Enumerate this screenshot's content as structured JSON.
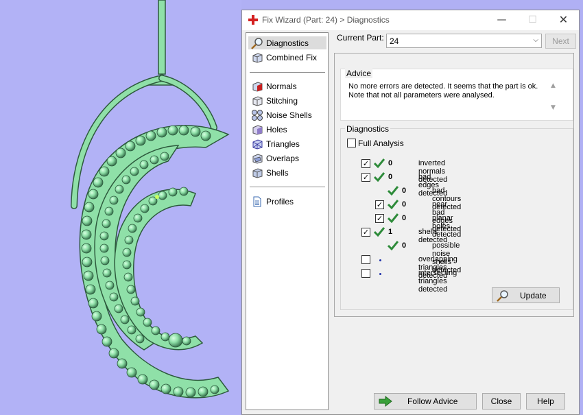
{
  "window": {
    "title": "Fix Wizard (Part: 24) > Diagnostics",
    "min_glyph": "—",
    "max_glyph": "☐",
    "close_glyph": "✕"
  },
  "sidebar": {
    "top_items": [
      {
        "label": "Diagnostics",
        "icon": "magnifier-icon",
        "selected": true
      },
      {
        "label": "Combined Fix",
        "icon": "cube-icon",
        "selected": false
      }
    ],
    "tool_items": [
      {
        "label": "Normals",
        "icon": "normals-cube-icon"
      },
      {
        "label": "Stitching",
        "icon": "stitching-cube-icon"
      },
      {
        "label": "Noise Shells",
        "icon": "noise-shells-icon"
      },
      {
        "label": "Holes",
        "icon": "holes-cube-icon"
      },
      {
        "label": "Triangles",
        "icon": "triangles-cube-icon"
      },
      {
        "label": "Overlaps",
        "icon": "overlaps-cube-icon"
      },
      {
        "label": "Shells",
        "icon": "shells-cube-icon"
      }
    ],
    "bottom_items": [
      {
        "label": "Profiles",
        "icon": "document-icon"
      }
    ]
  },
  "part": {
    "label": "Current Part:",
    "value": "24",
    "next_label": "Next"
  },
  "advice": {
    "title": "Advice",
    "text_line1": "No more errors are detected. It seems that the part is ok.",
    "text_line2": "Note that not all parameters were analysed."
  },
  "diagnostics": {
    "title": "Diagnostics",
    "full_analysis_label": "Full Analysis",
    "full_analysis_checked": false,
    "rows": [
      {
        "checkbox": true,
        "checked": true,
        "status": "ok",
        "count": "0",
        "label": "inverted normals detected",
        "indent": 0
      },
      {
        "checkbox": true,
        "checked": true,
        "status": "ok",
        "count": "0",
        "label": "bad edges detected",
        "indent": 0
      },
      {
        "checkbox": false,
        "checked": false,
        "status": "ok",
        "count": "0",
        "label": "bad contours detected",
        "indent": 1
      },
      {
        "checkbox": true,
        "checked": true,
        "status": "ok",
        "count": "0",
        "label": "near bad edges detected",
        "indent": 1
      },
      {
        "checkbox": true,
        "checked": true,
        "status": "ok",
        "count": "0",
        "label": "planar holes detected",
        "indent": 1
      },
      {
        "checkbox": true,
        "checked": true,
        "status": "ok",
        "count": "1",
        "label": "shells detected",
        "indent": 0
      },
      {
        "checkbox": false,
        "checked": false,
        "status": "ok",
        "count": "0",
        "label": "possible noise shells detected",
        "indent": 1
      },
      {
        "checkbox": true,
        "checked": false,
        "status": "pending",
        "count": "",
        "label": "overlapping triangles detected",
        "indent": 0
      },
      {
        "checkbox": true,
        "checked": false,
        "status": "pending",
        "count": "",
        "label": "intersecting triangles detected",
        "indent": 0
      }
    ],
    "update_label": "Update"
  },
  "footer": {
    "follow_advice_label": "Follow Advice",
    "close_label": "Close",
    "help_label": "Help"
  },
  "colors": {
    "viewport_bg": "#b2b2f6",
    "model_fill": "#8fe0a8",
    "check_green": "#2e8b3a",
    "arrow_green": "#3aa03a"
  }
}
